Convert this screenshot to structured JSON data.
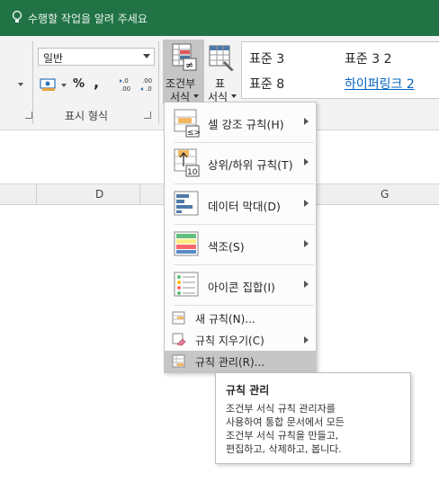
{
  "tell_me": {
    "placeholder": "수행할 작업을 알려 주세요"
  },
  "ribbon": {
    "number_format_value": "일반",
    "percent_symbol": "%",
    "comma_symbol": ",",
    "group_label": "표시 형식",
    "conditional_formatting": {
      "line1": "조건부",
      "line2": "서식"
    },
    "format_as_table": {
      "line1": "표",
      "line2": "서식"
    },
    "styles": [
      {
        "label": "표준 3"
      },
      {
        "label": "표준 3 2"
      },
      {
        "label": "표준 8"
      },
      {
        "label": "하이퍼링크 2"
      }
    ]
  },
  "sheet": {
    "columns": [
      "D",
      "G"
    ]
  },
  "menu": {
    "items": [
      {
        "label": "셀 강조 규칙(H)"
      },
      {
        "label": "상위/하위 규칙(T)"
      },
      {
        "label": "데이터 막대(D)"
      },
      {
        "label": "색조(S)"
      },
      {
        "label": "아이콘 집합(I)"
      }
    ],
    "new_rule": "새 규칙(N)...",
    "clear_rules": "규칙 지우기(C)",
    "manage_rules": "규칙 관리(R)..."
  },
  "tooltip": {
    "title": "규칙 관리",
    "body": "조건부 서식 규칙 관리자를\n사용하여 통합 문서에서 모든\n조건부 서식 규칙을 만들고,\n편집하고, 삭제하고, 봅니다."
  },
  "colors": {
    "excel_green": "#217346",
    "highlight": "#c6c6c6",
    "link": "#0563c1"
  }
}
